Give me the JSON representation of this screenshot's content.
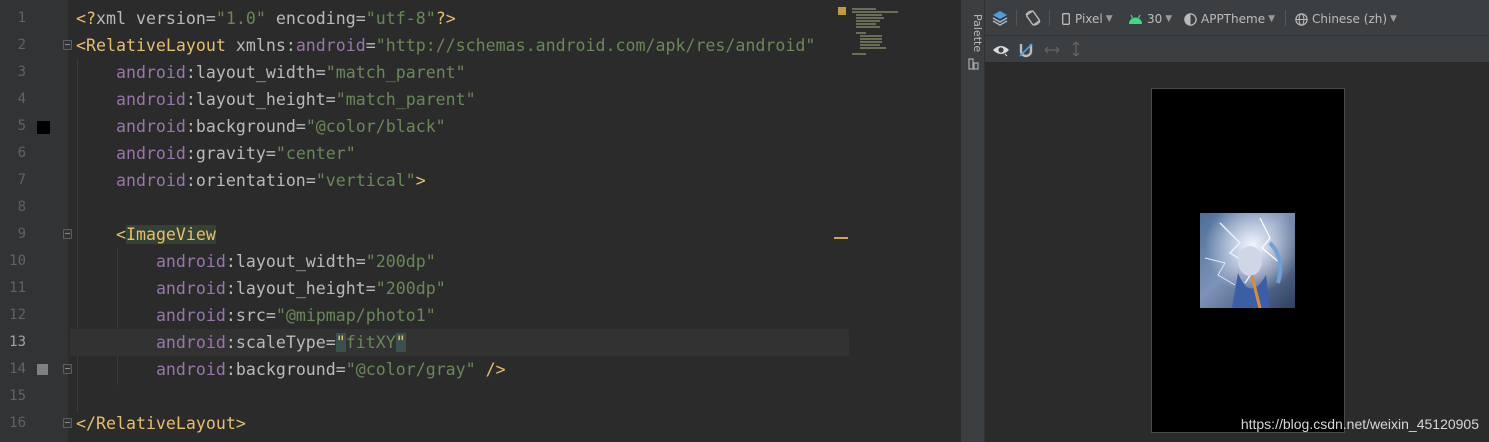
{
  "editor": {
    "lines": [
      {
        "n": "1"
      },
      {
        "n": "2"
      },
      {
        "n": "3"
      },
      {
        "n": "4"
      },
      {
        "n": "5"
      },
      {
        "n": "6"
      },
      {
        "n": "7"
      },
      {
        "n": "8"
      },
      {
        "n": "9"
      },
      {
        "n": "10"
      },
      {
        "n": "11"
      },
      {
        "n": "12"
      },
      {
        "n": "13"
      },
      {
        "n": "14"
      },
      {
        "n": "15"
      },
      {
        "n": "16"
      }
    ],
    "current_line": "13",
    "code": {
      "l1_open": "<?",
      "l1_xml": "xml ",
      "l1_version_attr": "version",
      "l1_version_val": "\"1.0\"",
      "l1_encoding_attr": "encoding",
      "l1_encoding_val": "\"utf-8\"",
      "l1_close": "?>",
      "l2_tag": "<RelativeLayout",
      "l2_xmlns": "xmlns",
      "l2_android": "android",
      "l2_url": "\"http://schemas.android.com/apk/res/android\"",
      "ns": "android",
      "a_layout_width": "layout_width",
      "a_layout_height": "layout_height",
      "a_background": "background",
      "a_gravity": "gravity",
      "a_orientation": "orientation",
      "a_src": "src",
      "a_scaleType": "scaleType",
      "v_match_parent": "\"match_parent\"",
      "v_color_black": "\"@color/black\"",
      "v_center": "\"center\"",
      "v_vertical": "\"vertical\"",
      "v_200dp": "\"200dp\"",
      "v_photo": "\"@mipmap/photo1\"",
      "v_fitxy_q": "\"",
      "v_fitxy": "fitXY",
      "v_color_gray": "\"@color/gray\"",
      "gt": ">",
      "selfclose": " />",
      "lt": "<",
      "imageview": "ImageView",
      "close_tag": "</RelativeLayout>",
      "eq": "=",
      "colon": ":"
    },
    "swatch_colors": {
      "black": "#000000",
      "gray": "#808080"
    }
  },
  "palette": {
    "label": "Palette"
  },
  "design_toolbar": {
    "layers_icon": "layers-icon",
    "rotate_icon": "rotate-icon",
    "device": "Pixel",
    "api": "30",
    "theme": "APPTheme",
    "locale": "Chinese (zh)",
    "eye_icon": "eye-icon",
    "magnet_icon": "magnet-icon",
    "h_arrows_icon": "horizontal-arrows-icon",
    "v_arrows_icon": "vertical-arrows-icon"
  },
  "watermark": "https://blog.csdn.net/weixin_45120905"
}
